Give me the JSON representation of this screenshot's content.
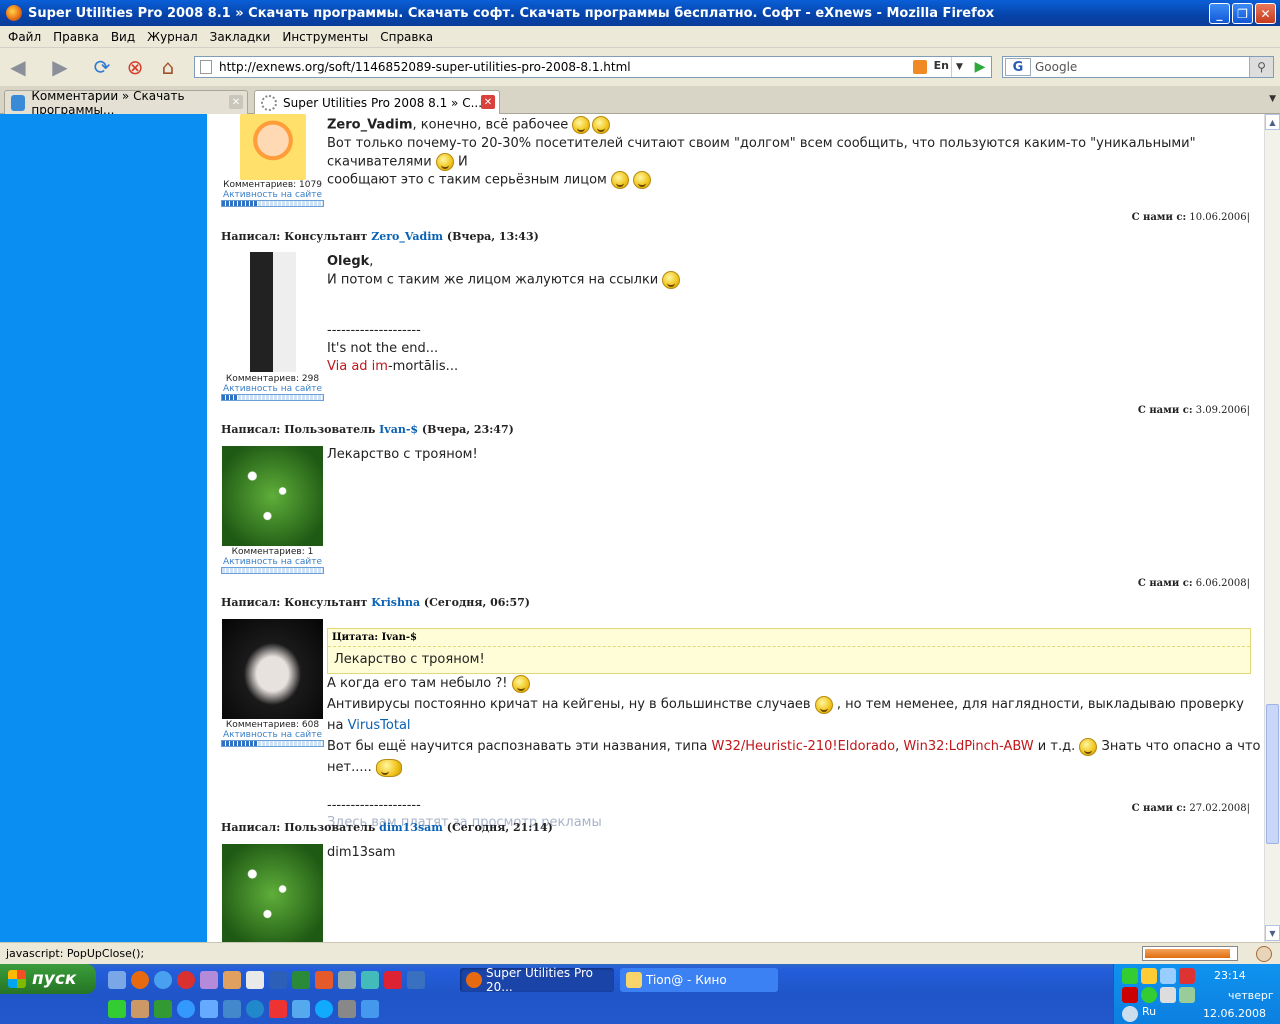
{
  "window": {
    "title": "Super Utilities Pro 2008 8.1 » Скачать программы. Скачать софт. Скачать программы бесплатно. Софт - eXnews - Mozilla Firefox"
  },
  "menu": [
    "Файл",
    "Правка",
    "Вид",
    "Журнал",
    "Закладки",
    "Инструменты",
    "Справка"
  ],
  "nav": {
    "url": "http://exnews.org/soft/1146852089-super-utilities-pro-2008-8.1.html",
    "lang_indicator": "En",
    "search_placeholder": "Google"
  },
  "tabs": [
    {
      "label": "Комментарии » Скачать программы..."
    },
    {
      "label": "Super Utilities Pro 2008 8.1 » С..."
    }
  ],
  "comments": [
    {
      "line1_name": "Zero_Vadim",
      "line1_text": ", конечно, всё рабочее",
      "line2": "Вот только почему-то 20-30% посетителей считают своим \"долгом\" всем сообщить, что пользуются каким-то \"уникальными\" скачивателями",
      "line2_tail": "И",
      "line3": "сообщают это с таким серьёзным лицом",
      "count_label": "Комментариев: 1079",
      "activity_label": "Активность на сайте",
      "activity_level": 0.35,
      "since_label": "С нами с:",
      "since_date": "10.06.2006"
    },
    {
      "head_prefix": "Написал: Консультант",
      "user": "Zero_Vadim",
      "time": "(Вчера, 13:43)",
      "addressee": "Olegk",
      "line1": "И потом с таким же лицом жалуются на ссылки",
      "separator": "--------------------",
      "sig1": "It's not the end...",
      "sig2_a": "Via ",
      "sig2_b": "ad im",
      "sig2_c": "-mortālis...",
      "count_label": "Комментариев: 298",
      "activity_label": "Активность на сайте",
      "activity_level": 0.15,
      "since_label": "С нами с:",
      "since_date": "3.09.2006"
    },
    {
      "head_prefix": "Написал: Пользователь",
      "user": "Ivan-$",
      "time": "(Вчера, 23:47)",
      "line1": "Лекарство с трояном!",
      "count_label": "Комментариев: 1",
      "activity_label": "Активность на сайте",
      "activity_level": 0.0,
      "since_label": "С нами с:",
      "since_date": "6.06.2008"
    },
    {
      "head_prefix": "Написал: Консультант",
      "user": "Krishna",
      "time": "(Сегодня, 06:57)",
      "quote_header": "Цитата: Ivan-$",
      "quote_body": "Лекарство с трояном!",
      "line1": "А когда его там небыло ?!",
      "line2_a": "Антивирусы постоянно кричат на кейгены, ну в большинстве случаев",
      "line2_b": ", но тем неменее, для наглядности, выкладываю проверку на",
      "line2_link": "VirusTotal",
      "line3_a": "Вот бы ещё научится распознавать эти названия, типа",
      "line3_v1": "W32/Heuristic-210!Eldorado",
      "line3_sep": ",",
      "line3_v2": "Win32:LdPinch-ABW",
      "line3_b": "и т.д.",
      "line3_c": "Знать что опасно а что нет.....",
      "separator": "--------------------",
      "sig": "Здесь вам платят за просмотр рекламы",
      "count_label": "Комментариев: 608",
      "activity_label": "Активность на сайте",
      "activity_level": 0.35,
      "since_label": "С нами с:",
      "since_date": "27.02.2008"
    },
    {
      "head_prefix": "Написал: Пользователь",
      "user": "dim13sam",
      "time": "(Сегодня, 21:14)",
      "line1": "dim13sam"
    }
  ],
  "status": {
    "text": "javascript: PopUpClose();"
  },
  "taskbar": {
    "start_label": "пуск",
    "items": [
      {
        "label": "Super Utilities Pro 20..."
      },
      {
        "label": "Tion@ - Кино"
      }
    ],
    "clock": "23:14",
    "day": "четверг",
    "date": "12.06.2008",
    "lang": "Ru"
  },
  "colors": {
    "accent_blue": "#0b8ef2",
    "link_blue": "#0b62b5",
    "virus_red": "#c0171b"
  }
}
